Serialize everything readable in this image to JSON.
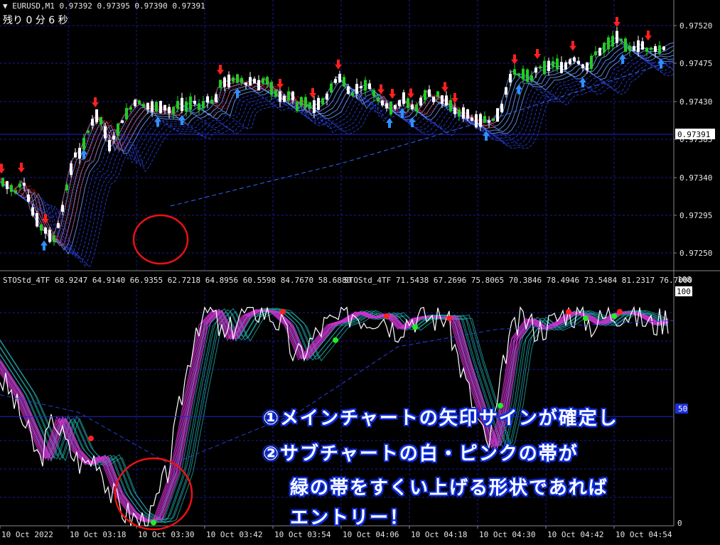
{
  "header": {
    "symbol_line": "EURUSD,M1  0.97392 0.97395 0.97390 0.97391",
    "countdown": "残り 0 分 6 秒"
  },
  "main_chart": {
    "price_labels": [
      "0.97520",
      "0.97475",
      "0.97430",
      "0.97385",
      "0.97340",
      "0.97295",
      "0.97250"
    ],
    "current_price": "0.97391",
    "price_range": [
      0.97225,
      0.97555
    ],
    "colors": {
      "bull": "#22cc22",
      "bear": "#ffffff",
      "up_arrow": "#2f8fff",
      "down_arrow": "#ff2020",
      "red_band": "#cc1010",
      "blue_band": "#3366ff",
      "circle": "#ee1111",
      "grid": "#1a1a9a",
      "price_line": "#2222cc"
    }
  },
  "sub_chart": {
    "indicator_text_1": "STOStd_4TF 68.9247 64.9140 66.9355 62.7218 64.8956 60.5598 84.7670 58.6880",
    "indicator_text_2": "STOStd_4TF 71.5438 67.2696 75.8065 70.3846 78.4946 73.5484 81.2317 76.7000",
    "scale_labels": {
      "top": "108",
      "high": "100",
      "mid": "50",
      "low": "0"
    },
    "colors": {
      "pink": "#d030d0",
      "teal": "#20a0a0",
      "white": "#ffffff",
      "dot_red": "#ff2020",
      "dot_green": "#22ee22"
    }
  },
  "time_axis": [
    "10 Oct 2022",
    "10 Oct 03:18",
    "10 Oct 03:30",
    "10 Oct 03:42",
    "10 Oct 03:54",
    "10 Oct 04:06",
    "10 Oct 04:18",
    "10 Oct 04:30",
    "10 Oct 04:42",
    "10 Oct 04:54"
  ],
  "overlay_text": {
    "line1": "①メインチャートの矢印サインが確定し",
    "line2": "②サブチャートの白・ピンクの帯が",
    "line3": "緑の帯をすくい上げる形状であれば",
    "line4": "エントリー！"
  }
}
